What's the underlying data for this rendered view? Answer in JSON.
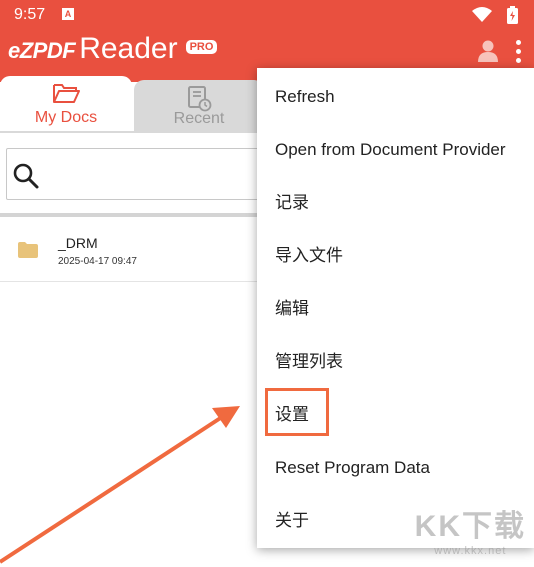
{
  "status_bar": {
    "time": "9:57",
    "notification_icon": "a-box-icon",
    "wifi_icon": "wifi-icon",
    "battery_icon": "battery-icon"
  },
  "app_bar": {
    "logo": "eZPDF",
    "title": "Reader",
    "badge": "PRO",
    "accent_color": "#e9503f"
  },
  "tabs": [
    {
      "label": "My Docs",
      "icon": "folder-open-icon",
      "active": true
    },
    {
      "label": "Recent",
      "icon": "recent-doc-icon",
      "active": false
    }
  ],
  "search": {
    "placeholder": "",
    "value": ""
  },
  "files": [
    {
      "name": "_DRM",
      "date": "2025-04-17 09:47",
      "icon": "folder-icon"
    }
  ],
  "menu": {
    "items": [
      {
        "label": "Refresh"
      },
      {
        "label": "Open from Document Provider"
      },
      {
        "label": "记录"
      },
      {
        "label": "导入文件"
      },
      {
        "label": "编辑"
      },
      {
        "label": "管理列表"
      },
      {
        "label": "设置",
        "highlighted": true
      },
      {
        "label": "Reset Program Data"
      },
      {
        "label": "关于"
      }
    ]
  },
  "watermark": {
    "logo": "KK下载",
    "url": "www.kkx.net"
  }
}
